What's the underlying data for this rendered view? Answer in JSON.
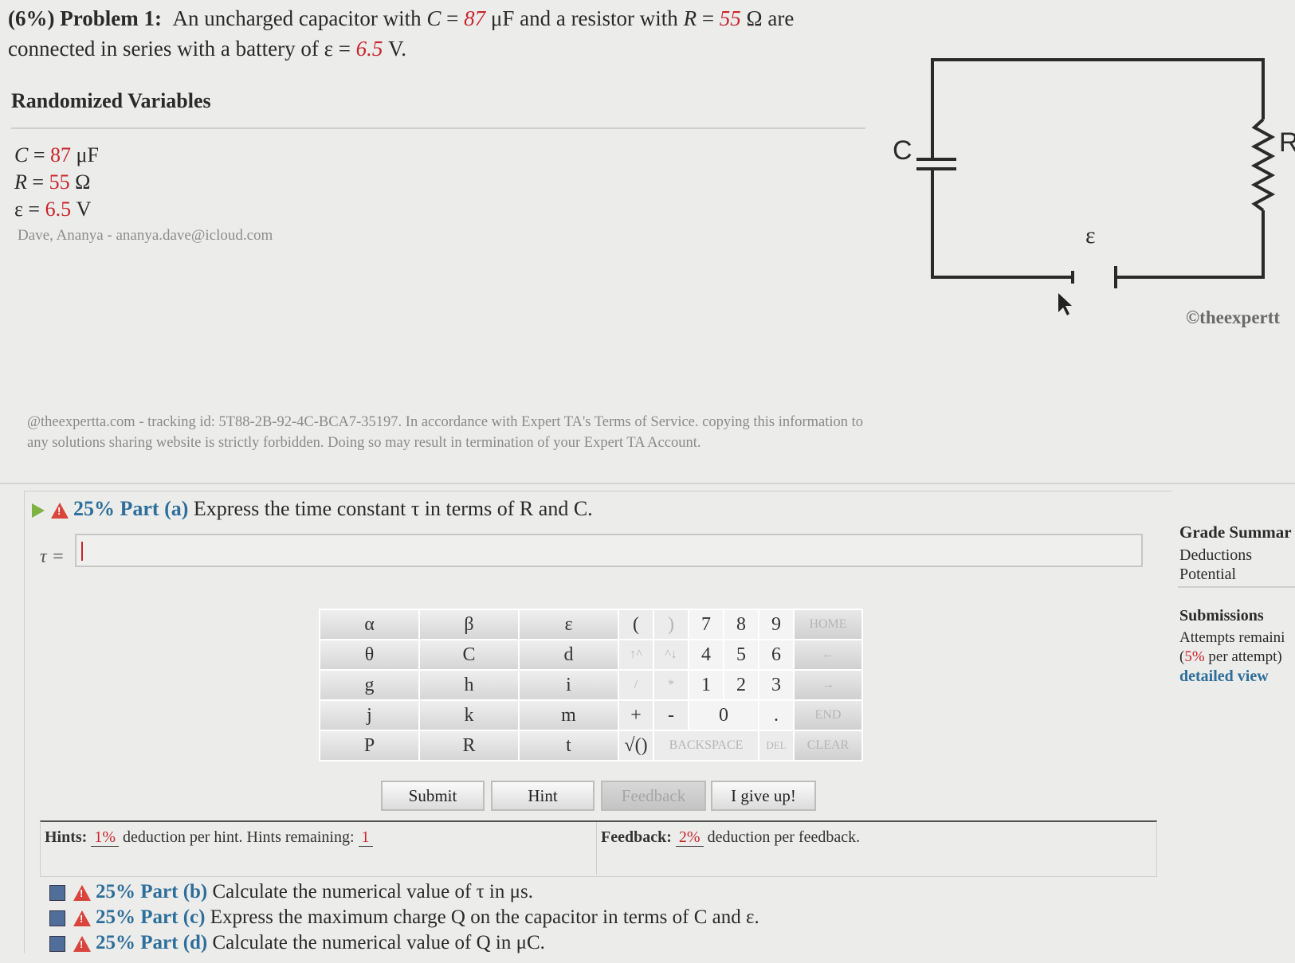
{
  "problem": {
    "weight": "(6%)",
    "title": "Problem 1:",
    "text_1": "An uncharged capacitor with",
    "c_sym": "C",
    "c_val": "87",
    "c_unit": "μF and a resistor with",
    "r_sym": "R",
    "r_val": "55",
    "r_unit": "Ω are",
    "line2_a": "connected in series with a battery of ε =",
    "emf_val": "6.5",
    "line2_b": "V."
  },
  "randomized": {
    "title": "Randomized Variables",
    "vars": [
      {
        "sym": "C",
        "val": "87",
        "unit": "μF"
      },
      {
        "sym": "R",
        "val": "55",
        "unit": "Ω"
      },
      {
        "sym": "ε",
        "val": "6.5",
        "unit": "V"
      }
    ],
    "user": "Dave, Ananya - ananya.dave@icloud.com"
  },
  "notice": "@theexpertta.com - tracking id: 5T88-2B-92-4C-BCA7-35197. In accordance with Expert TA's Terms of Service. copying this information to any solutions sharing website is strictly forbidden. Doing so may result in termination of your Expert TA Account.",
  "circuit": {
    "label_c": "C",
    "label_r": "R",
    "label_emf": "ε",
    "copyright": "©theexpertt"
  },
  "part_a": {
    "percent_label": "25% Part (a)",
    "text": "Express the time constant τ in terms of R and C.",
    "answer_label": "τ =",
    "answer_value": ""
  },
  "keypad": {
    "rows": [
      [
        "α",
        "β",
        "ε",
        "(",
        ")",
        "7",
        "8",
        "9",
        "HOME"
      ],
      [
        "θ",
        "C",
        "d",
        "↑^",
        "^↓",
        "4",
        "5",
        "6",
        "←"
      ],
      [
        "g",
        "h",
        "i",
        "/",
        "*",
        "1",
        "2",
        "3",
        "→"
      ],
      [
        "j",
        "k",
        "m",
        "+",
        "-",
        "0",
        ".",
        "END"
      ],
      [
        "P",
        "R",
        "t",
        "√()",
        "BACKSPACE",
        "DEL",
        "CLEAR"
      ]
    ]
  },
  "buttons": {
    "submit": "Submit",
    "hint": "Hint",
    "feedback": "Feedback",
    "give_up": "I give up!"
  },
  "hints": {
    "label": "Hints:",
    "pct": "1%",
    "text": "deduction per hint. Hints remaining:",
    "remaining": "1"
  },
  "feedback": {
    "label": "Feedback:",
    "pct": "2%",
    "text": "deduction per feedback."
  },
  "other_parts": [
    {
      "label": "25% Part (b)",
      "text": "Calculate the numerical value of τ in μs."
    },
    {
      "label": "25% Part (c)",
      "text": "Express the maximum charge Q on the capacitor in terms of C and ε."
    },
    {
      "label": "25% Part (d)",
      "text": "Calculate the numerical value of Q in μC."
    }
  ],
  "sidebar": {
    "grade_title": "Grade Summar",
    "deductions": "Deductions",
    "potential": "Potential",
    "submissions_title": "Submissions",
    "attempts": "Attempts remaini",
    "per_attempt_pct": "5%",
    "per_attempt_a": "(",
    "per_attempt_b": "per attempt)",
    "detailed_view": "detailed view"
  },
  "colors": {
    "accent_red": "#c8262b",
    "part_blue": "#2d6e9a",
    "link_blue": "#2d6e9a"
  }
}
